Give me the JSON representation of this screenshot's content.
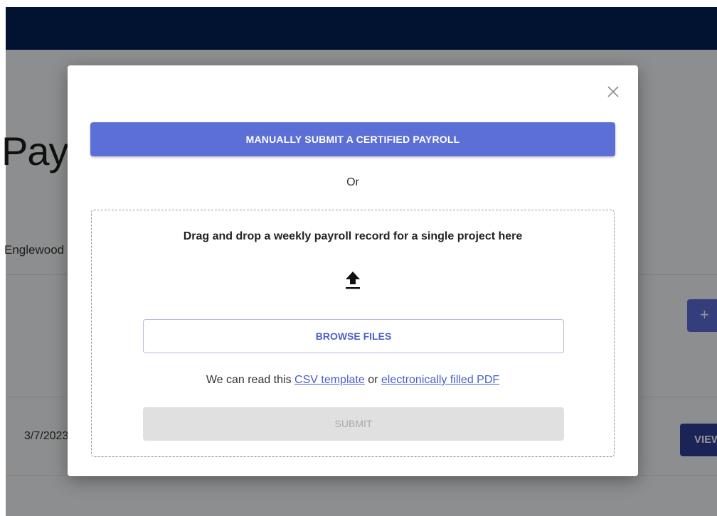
{
  "background": {
    "title": "Payroll",
    "subtitle": "Englewood",
    "add_button": "+",
    "row_date": "3/7/2023",
    "view_button": "VIEW"
  },
  "modal": {
    "close_icon": "close-icon",
    "manual_button": "MANUALLY SUBMIT A CERTIFIED PAYROLL",
    "or_text": "Or",
    "dropzone": {
      "heading": "Drag and drop a weekly payroll record for a single project here",
      "upload_icon": "upload-icon",
      "browse_button": "BROWSE FILES",
      "info_prefix": "We can read this",
      "csv_link": "CSV template",
      "info_or": "or",
      "pdf_link": "electronically filled PDF",
      "submit_button": "SUBMIT"
    }
  },
  "colors": {
    "topbar": "#021331",
    "primary": "#5b6fd7",
    "link": "#4a5fcc",
    "disabled": "#e0e0e0"
  }
}
